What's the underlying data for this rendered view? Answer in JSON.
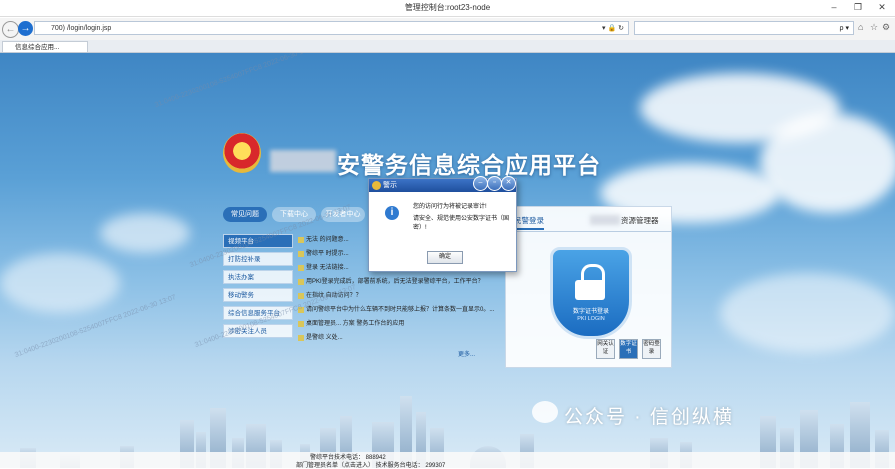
{
  "window": {
    "title": "管理控制台:root23-node"
  },
  "browser": {
    "address": "700)      /login/login.jsp",
    "tab_label": "    信息综合应用...",
    "address_icons": "▾ 🔒 ↻",
    "search_icons": "ρ ▾"
  },
  "page": {
    "platform_title": "公安警务信息综合应用平台",
    "platform_title_visible": "安警务信息综合应用平台",
    "nav_tabs": [
      "常见问题",
      "下载中心",
      "开发者中心"
    ],
    "left_menu": [
      "视频平台",
      "打防控补录",
      "执法办案",
      "移动警务",
      "综合信息服务平台",
      "涉密关注人员"
    ],
    "news_items": [
      "无法      的问题意...",
      "警综平      时提示...",
      "登录      无法链接...",
      "用PKI登录完成后，部署前系统，后无法登录警综平台，工作平台？",
      "在指纹      自动访问？？",
      "请问警综平台中为什么车辆不到时只能够上报？计算条数一直显示0。...",
      "桌面管理员...      方案 警务工作台的应用",
      "是警综    义处..."
    ],
    "more_label": "更多...",
    "login_tabs": [
      "民警登录",
      "资源管理器"
    ],
    "shield_label_1": "数字证书登录",
    "shield_label_2": "PKI LOGIN",
    "login_buttons": [
      "网关认证",
      "数字证书",
      "密码登录"
    ],
    "footer_line1": "警综平台技术电话：      888942",
    "footer_line2": "部门管理员名单（点击进入）      技术服务台电话：   299307",
    "brand_text": "公众号 · 信创纵横",
    "watermark": "31:0400-2230200108-5254007FFC8 2022-06-30 13:07"
  },
  "dialog": {
    "title": "警示",
    "message_line1": "您的访问行为将被记录审计!",
    "message_line2": "请安全、规范使用公安数字证书（国密）!",
    "ok_label": "确定"
  },
  "colors": {
    "sky_top": "#3f86c4",
    "dialog_bar": "#1f4f9d",
    "menu_active": "#2a6fb8",
    "shield": "#1b6cc1"
  }
}
